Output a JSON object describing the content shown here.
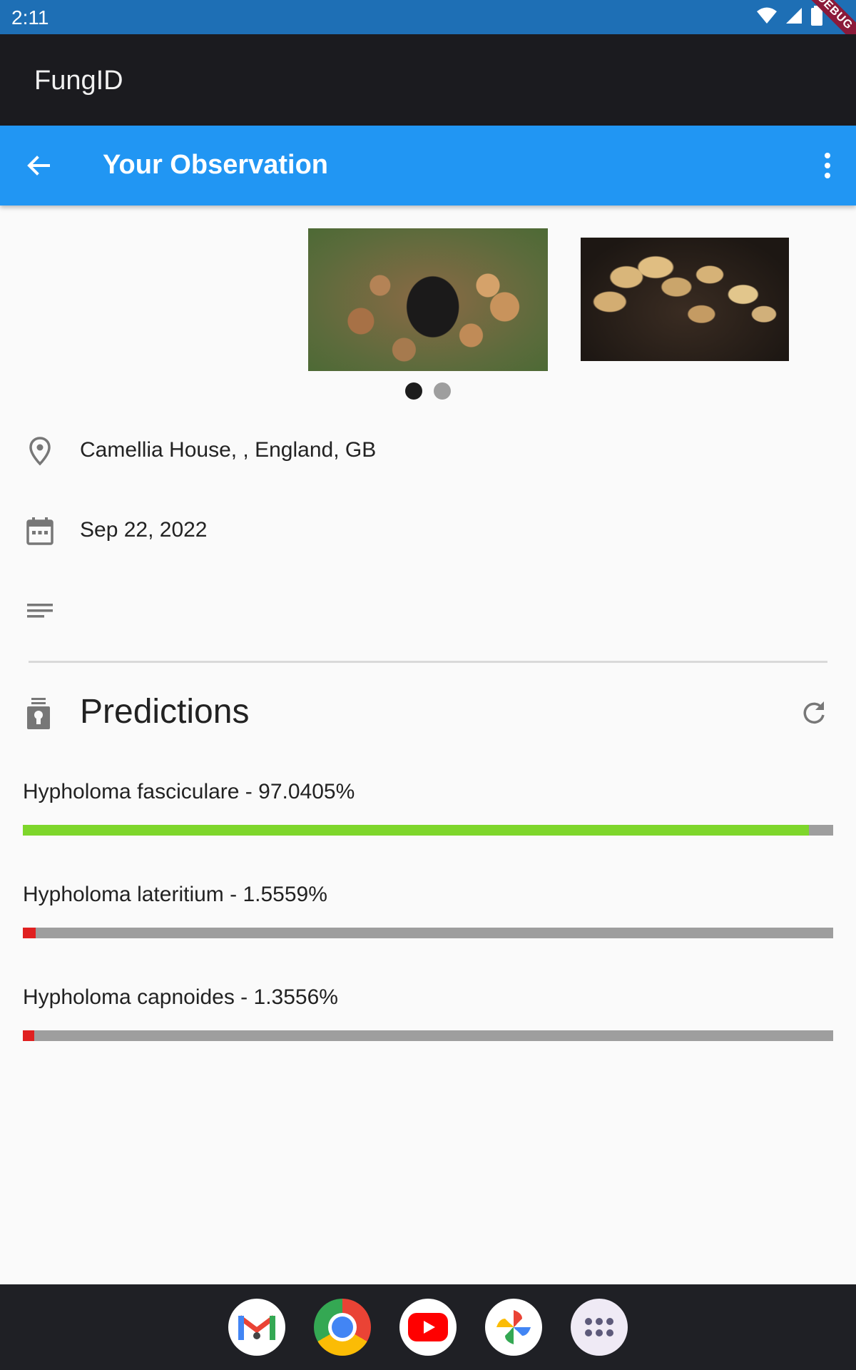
{
  "status_bar": {
    "time": "2:11",
    "debug_label": "DEBUG"
  },
  "app_bar": {
    "title": "FungID"
  },
  "toolbar": {
    "title": "Your Observation",
    "back_icon": "arrow-back-icon",
    "more_icon": "more-vert-icon"
  },
  "carousel": {
    "page_count": 2,
    "active_index": 0
  },
  "observation": {
    "location": "Camellia House, , England, GB",
    "date": "Sep 22, 2022",
    "notes": ""
  },
  "predictions": {
    "title": "Predictions",
    "items": [
      {
        "label": "Hypholoma fasciculare - 97.0405%",
        "value": 97.0405,
        "color": "#7ed62b"
      },
      {
        "label": "Hypholoma lateritium - 1.5559%",
        "value": 1.5559,
        "color": "#e02020"
      },
      {
        "label": "Hypholoma capnoides - 1.3556%",
        "value": 1.3556,
        "color": "#e02020"
      }
    ]
  },
  "dock": {
    "apps": [
      "gmail-icon",
      "chrome-icon",
      "youtube-icon",
      "photos-icon",
      "app-drawer-icon"
    ]
  },
  "colors": {
    "status_bar": "#1e6fb5",
    "app_bar": "#1b1b1f",
    "toolbar": "#2196f3",
    "bar_track": "#9e9e9e"
  }
}
